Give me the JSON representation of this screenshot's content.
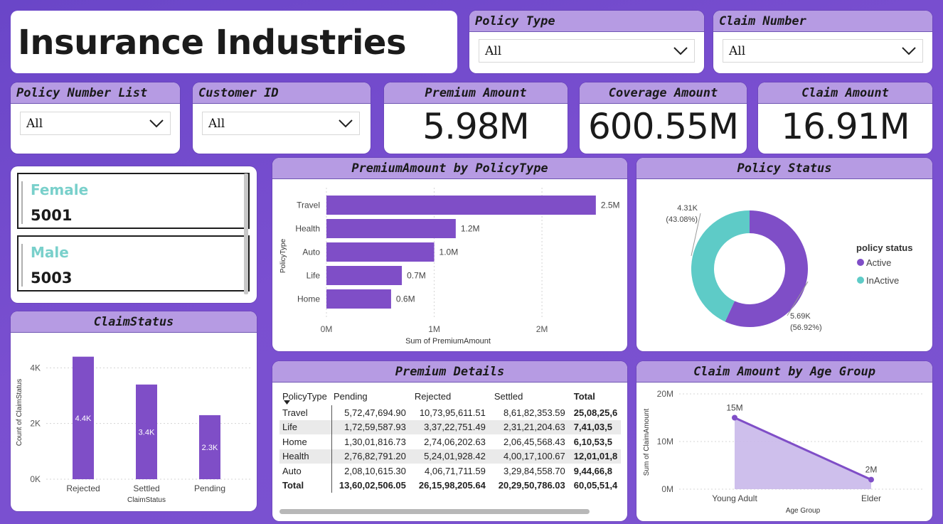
{
  "title": "Insurance Industries",
  "filters": {
    "policy_type": {
      "label": "Policy Type",
      "value": "All"
    },
    "claim_number": {
      "label": "Claim Number",
      "value": "All"
    },
    "policy_number_list": {
      "label": "Policy Number List",
      "value": "All"
    },
    "customer_id": {
      "label": "Customer ID",
      "value": "All"
    }
  },
  "kpis": {
    "premium": {
      "label": "Premium Amount",
      "value": "5.98M"
    },
    "coverage": {
      "label": "Coverage Amount",
      "value": "600.55M"
    },
    "claim": {
      "label": "Claim Amount",
      "value": "16.91M"
    }
  },
  "gender": [
    {
      "label": "Female",
      "value": "5001"
    },
    {
      "label": "Male",
      "value": "5003"
    }
  ],
  "colors": {
    "accent": "#7f4ec7",
    "header": "#b69be3",
    "teal": "#5ecbc7",
    "area_fill": "#c9b8ea"
  },
  "chart_data": [
    {
      "id": "premium-by-policytype",
      "type": "bar",
      "title": "PremiumAmount by PolicyType",
      "orientation": "horizontal",
      "categories": [
        "Travel",
        "Health",
        "Auto",
        "Life",
        "Home"
      ],
      "values": [
        2.5,
        1.2,
        1.0,
        0.7,
        0.6
      ],
      "data_labels": [
        "2.5M",
        "1.2M",
        "1.0M",
        "0.7M",
        "0.6M"
      ],
      "xlabel": "Sum of PremiumAmount",
      "ylabel": "PolicyType",
      "xlim": [
        0,
        2.6
      ],
      "xticks": [
        0,
        1,
        2
      ],
      "xtick_labels": [
        "0M",
        "1M",
        "2M"
      ],
      "grid": true
    },
    {
      "id": "policy-status",
      "type": "pie",
      "donut": true,
      "title": "Policy Status",
      "legend_title": "policy status",
      "legend_position": "right",
      "slices": [
        {
          "name": "Active",
          "value": 5.69,
          "label": "5.69K",
          "pct": "(56.92%)",
          "color": "#7f4ec7"
        },
        {
          "name": "InActive",
          "value": 4.31,
          "label": "4.31K",
          "pct": "(43.08%)",
          "color": "#5ecbc7"
        }
      ]
    },
    {
      "id": "claim-status",
      "type": "bar",
      "title": "ClaimStatus",
      "categories": [
        "Rejected",
        "Settled",
        "Pending"
      ],
      "values": [
        4.4,
        3.4,
        2.3
      ],
      "data_labels": [
        "4.4K",
        "3.4K",
        "2.3K"
      ],
      "xlabel": "ClaimStatus",
      "ylabel": "Count of ClaimStatus",
      "ylim": [
        0,
        4.8
      ],
      "yticks": [
        0,
        2,
        4
      ],
      "ytick_labels": [
        "0K",
        "2K",
        "4K"
      ],
      "grid": true
    },
    {
      "id": "claim-by-age",
      "type": "area",
      "title": "Claim Amount by Age Group",
      "categories": [
        "Young Adult",
        "Elder"
      ],
      "values": [
        15,
        2
      ],
      "data_labels": [
        "15M",
        "2M"
      ],
      "xlabel": "Age Group",
      "ylabel": "Sum of ClaimAmount",
      "ylim": [
        0,
        20
      ],
      "yticks": [
        0,
        10,
        20
      ],
      "ytick_labels": [
        "0M",
        "10M",
        "20M"
      ],
      "grid": true
    },
    {
      "id": "premium-details",
      "type": "table",
      "title": "Premium Details",
      "columns": [
        "PolicyType",
        "Pending",
        "Rejected",
        "Settled",
        "Total"
      ],
      "rows": [
        [
          "Travel",
          "5,72,47,694.90",
          "10,73,95,611.51",
          "8,61,82,353.59",
          "25,08,25,6"
        ],
        [
          "Life",
          "1,72,59,587.93",
          "3,37,22,751.49",
          "2,31,21,204.63",
          "7,41,03,5"
        ],
        [
          "Home",
          "1,30,01,816.73",
          "2,74,06,202.63",
          "2,06,45,568.43",
          "6,10,53,5"
        ],
        [
          "Health",
          "2,76,82,791.20",
          "5,24,01,928.42",
          "4,00,17,100.67",
          "12,01,01,8"
        ],
        [
          "Auto",
          "2,08,10,615.30",
          "4,06,71,711.59",
          "3,29,84,558.70",
          "9,44,66,8"
        ]
      ],
      "total": [
        "Total",
        "13,60,02,506.05",
        "26,15,98,205.64",
        "20,29,50,786.03",
        "60,05,51,4"
      ]
    }
  ]
}
